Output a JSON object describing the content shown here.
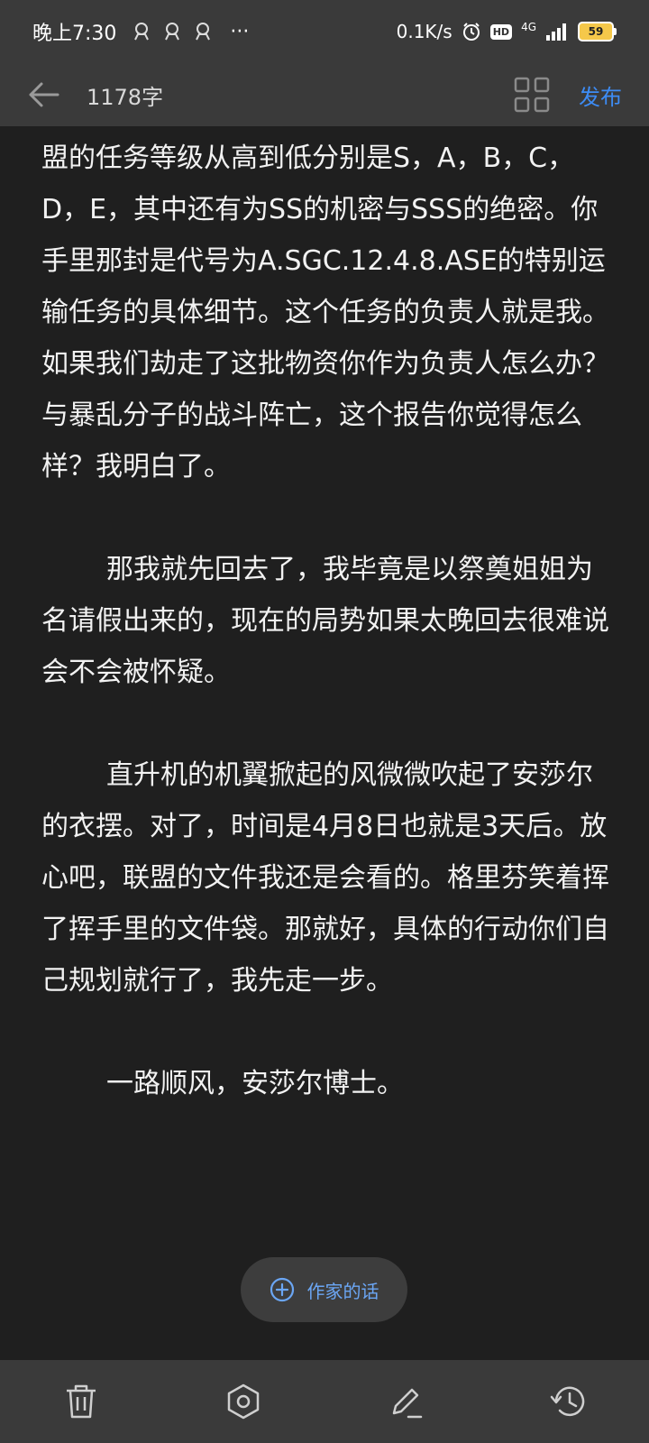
{
  "status_bar": {
    "time": "晚上7:30",
    "more": "···",
    "speed": "0.1K/s",
    "hd": "HD",
    "network": "4G",
    "battery": "59",
    "notification_icons": [
      "notification-icon",
      "notification-icon",
      "notification-icon"
    ]
  },
  "top_bar": {
    "word_count": "1178字",
    "publish_label": "发布"
  },
  "content": {
    "paragraphs": [
      "盟的任务等级从高到低分别是S，A，B，C，D，E，其中还有为SS的机密与SSS的绝密。你手里那封是代号为A.SGC.12.4.8.ASE的特别运输任务的具体细节。这个任务的负责人就是我。如果我们劫走了这批物资你作为负责人怎么办？与暴乱分子的战斗阵亡，这个报告你觉得怎么样？我明白了。",
      "那我就先回去了，我毕竟是以祭奠姐姐为名请假出来的，现在的局势如果太晚回去很难说会不会被怀疑。",
      "直升机的机翼掀起的风微微吹起了安莎尔的衣摆。对了，时间是4月8日也就是3天后。放心吧，联盟的文件我还是会看的。格里芬笑着挥了挥手里的文件袋。那就好，具体的行动你们自己规划就行了，我先走一步。",
      "一路顺风，安莎尔博士。"
    ]
  },
  "author_note": {
    "label": "作家的话"
  },
  "colors": {
    "background": "#1f1f1f",
    "bars": "#3a3a3a",
    "accent": "#3d8cf5",
    "text": "#f2f2f2"
  },
  "toolbar_icons": [
    "trash-icon",
    "hexagon-settings-icon",
    "pen-edit-icon",
    "history-icon"
  ]
}
